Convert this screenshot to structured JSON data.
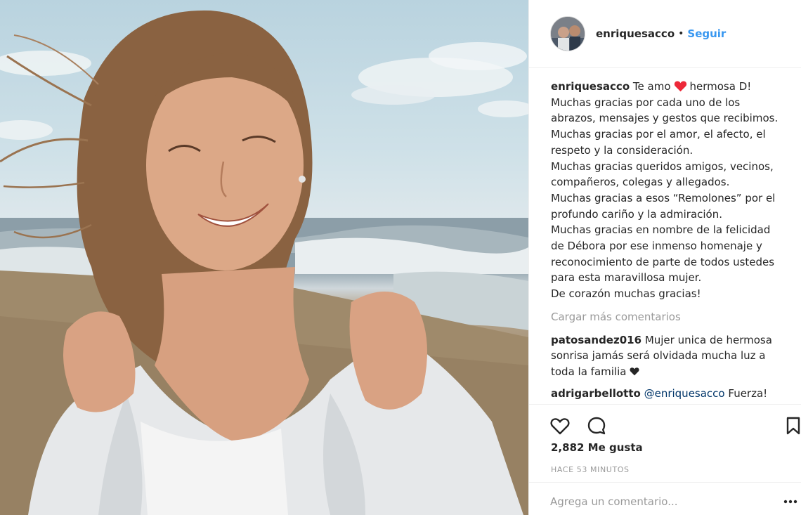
{
  "post": {
    "author": "enriquesacco",
    "separator": "•",
    "follow_label": "Seguir",
    "caption_user": "enriquesacco",
    "caption_first_before": "Te amo",
    "caption_first_after": "hermosa D!",
    "caption_lines": [
      "Muchas gracias por cada uno de los",
      "abrazos, mensajes y gestos que recibimos.",
      "Muchas gracias por el amor, el afecto, el",
      "respeto y la consideración.",
      "Muchas gracias queridos amigos, vecinos,",
      "compañeros, colegas y allegados.",
      "Muchas gracias a esos “Remolones” por el",
      "profundo cariño y la admiración.",
      "Muchas gracias en nombre de la felicidad",
      "de Débora por ese inmenso homenaje y",
      "reconocimiento de parte de todos ustedes",
      "para esta maravillosa mujer.",
      "De corazón muchas gracias!"
    ],
    "load_more": "Cargar más comentarios",
    "comments": [
      {
        "user": "patosandez016",
        "line1": "Mujer unica de hermosa",
        "line2": "sonrisa jamás será olvidada mucha luz a",
        "line3": "toda la familia",
        "trailing_icon": "black-heart-icon"
      },
      {
        "user": "adrigarbellotto",
        "mention": "@enriquesacco",
        "text": "Fuerza!"
      }
    ],
    "likes": "2,882 Me gusta",
    "time": "HACE 53 MINUTOS",
    "comment_placeholder": "Agrega un comentario...",
    "icons": {
      "like": "heart-outline-icon",
      "comment": "speech-bubble-icon",
      "save": "bookmark-icon",
      "more": "ellipsis-icon",
      "caption_heart": "red-heart-icon"
    },
    "colors": {
      "link_blue": "#3897f0",
      "mention_blue": "#003569",
      "heart_red": "#ed2939",
      "muted_gray": "#999999",
      "text": "#262626",
      "divider": "#efefef"
    }
  }
}
